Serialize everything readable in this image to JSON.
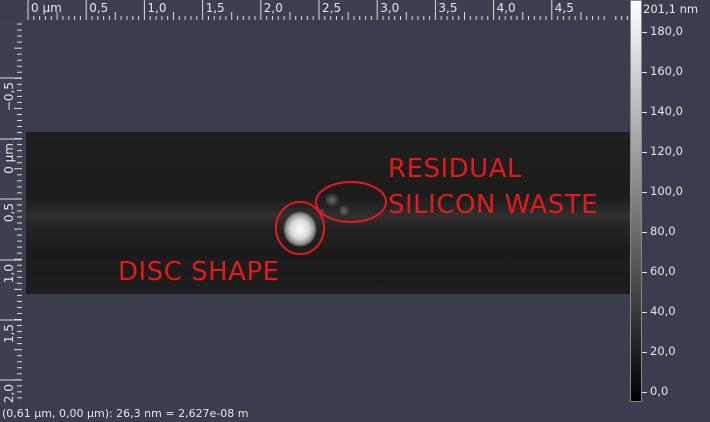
{
  "x_ruler": {
    "ticks": [
      "0 µm",
      "0,5",
      "1,0",
      "1,5",
      "2,0",
      "2,5",
      "3,0",
      "3,5",
      "4,0",
      "4,5"
    ]
  },
  "y_ruler": {
    "ticks": [
      "−0,5",
      "0 µm",
      "0,5",
      "1,0",
      "1,5",
      "2,0"
    ]
  },
  "colorbar": {
    "max_label": "201,1 nm",
    "ticks": [
      "180,0",
      "160,0",
      "140,0",
      "120,0",
      "100,0",
      "80,0",
      "60,0",
      "40,0",
      "20,0",
      "0,0"
    ],
    "top_color": "#ffffff",
    "bottom_color": "#000000"
  },
  "annotations": {
    "residual_line1": "RESIDUAL",
    "residual_line2": "SILICON WASTE",
    "disc_shape": "DISC SHAPE",
    "color": "#e31a1a"
  },
  "status": {
    "readout": "(0,61 µm, 0,00 µm): 26,3 nm = 2,627e-08 m"
  }
}
